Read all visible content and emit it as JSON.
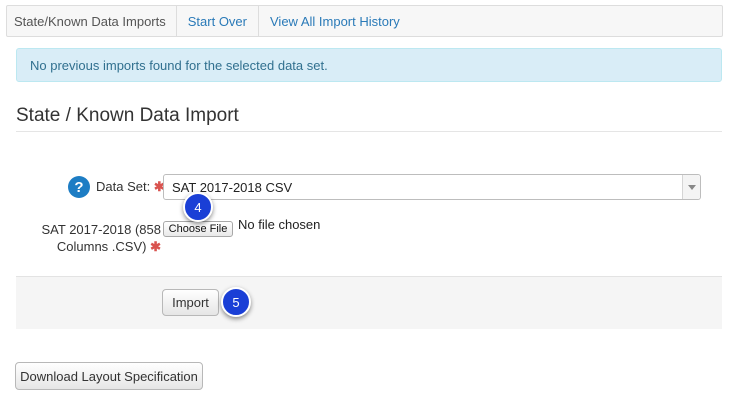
{
  "nav": {
    "brand": "State/Known Data Imports",
    "links": [
      "Start Over",
      "View All Import History"
    ]
  },
  "alert": {
    "message": "No previous imports found for the selected data set."
  },
  "section": {
    "title": "State / Known Data Import"
  },
  "form": {
    "help_icon": "question-circle-icon",
    "data_set_label": "Data Set:",
    "required_mark": "✱",
    "data_set_value": "SAT 2017-2018 CSV",
    "file_label_line1": "SAT 2017-2018 (858",
    "file_label_line2": "Columns .CSV)",
    "choose_file_label": "Choose File",
    "no_file_text": "No file chosen"
  },
  "actions": {
    "import_label": "Import",
    "download_label": "Download Layout Specification"
  },
  "steps": {
    "step_a": "4",
    "step_b": "5"
  },
  "colors": {
    "link": "#2a7ab8",
    "alert_bg": "#d9edf7",
    "alert_text": "#31708f",
    "required": "#d9534f",
    "help_icon": "#1d7dc4",
    "step_badge": "#1a3fd6"
  }
}
